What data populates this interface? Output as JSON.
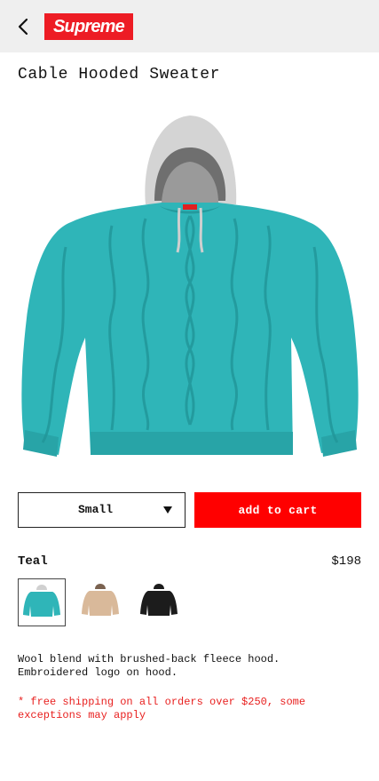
{
  "header": {
    "logo_text": "Supreme",
    "back_icon": "chevron-left-icon"
  },
  "product": {
    "title": "Cable Hooded Sweater",
    "image_icon": "hooded-sweater-image",
    "color_name": "Teal",
    "price": "$198",
    "description": "Wool blend with brushed-back fleece hood.\nEmbroidered logo on hood.",
    "shipping_note": "* free shipping on all orders over $250, some exceptions may apply"
  },
  "size_select": {
    "selected": "Small",
    "caret_icon": "caret-down-icon"
  },
  "cart": {
    "label": "add to cart"
  },
  "swatches": [
    {
      "color": "teal",
      "hex": "#2fb5b8",
      "selected": true
    },
    {
      "color": "tan",
      "hex": "#d9b99a",
      "selected": false
    },
    {
      "color": "black",
      "hex": "#1c1c1c",
      "selected": false
    }
  ],
  "colors": {
    "brand_red": "#ed1c24",
    "cart_red": "#ff0000",
    "topbar_bg": "#efefef",
    "shipping_red": "#e8201f"
  }
}
